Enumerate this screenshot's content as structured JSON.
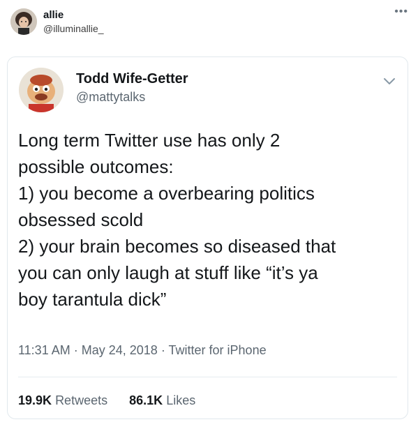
{
  "outer": {
    "name": "allie",
    "handle": "@illuminallie_",
    "more_icon": "more-horizontal-icon"
  },
  "quoted": {
    "name": "Todd Wife-Getter",
    "handle": "@mattytalks",
    "chevron_icon": "chevron-down-icon",
    "text": "Long term Twitter use has only 2\npossible outcomes:\n1) you become a overbearing politics\nobsessed scold\n2) your brain becomes so diseased that\nyou can only laugh at stuff like “it’s ya\nboy tarantula dick”",
    "time": "11:31 AM",
    "date": "May 24, 2018",
    "source": "Twitter for iPhone",
    "separator": "·",
    "retweets_count": "19.9K",
    "retweets_label": "Retweets",
    "likes_count": "86.1K",
    "likes_label": "Likes"
  },
  "colors": {
    "text_primary": "#14171a",
    "text_secondary": "#5b6670",
    "border": "#e1e8ed"
  }
}
